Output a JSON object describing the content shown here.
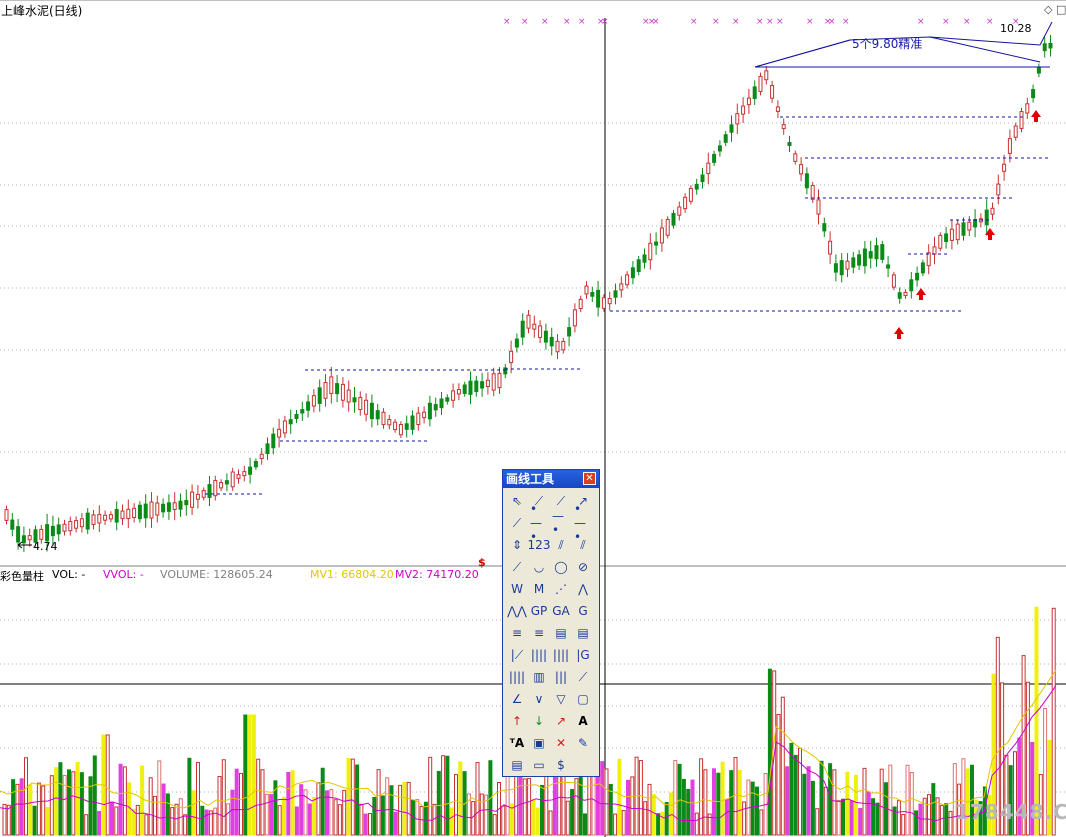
{
  "stock_title": "上峰水泥(日线)",
  "price_labels": {
    "low": "4.74",
    "high": "10.28"
  },
  "annotation": "5个9.80精准",
  "indicator_header": {
    "name": "彩色量柱",
    "vol": "VOL: -",
    "vvol": "VVOL: -",
    "volume": "VOLUME: 128605.24",
    "mv1": "MV1: 66804.20",
    "mv2": "MV2: 74170.20"
  },
  "toolbox": {
    "title": "画线工具",
    "close_icon": "close-icon",
    "tools": [
      {
        "name": "pointer-tool",
        "glyph": "⇖"
      },
      {
        "name": "segment-tool",
        "glyph": "⟋"
      },
      {
        "name": "line-tool",
        "glyph": "⟋"
      },
      {
        "name": "arrow-line-tool",
        "glyph": "↗"
      },
      {
        "name": "ray-tool",
        "glyph": "⟋"
      },
      {
        "name": "horizontal-segment-tool",
        "glyph": "•—•"
      },
      {
        "name": "horizontal-line-tool",
        "glyph": "—•"
      },
      {
        "name": "horizontal-ray-tool",
        "glyph": "•—•"
      },
      {
        "name": "vertical-line-tool",
        "glyph": "⇕"
      },
      {
        "name": "price-label-tool",
        "glyph": "123"
      },
      {
        "name": "parallel-line-tool",
        "glyph": "⫽"
      },
      {
        "name": "channel-tool",
        "glyph": "⫽"
      },
      {
        "name": "regression-tool",
        "glyph": "⟋"
      },
      {
        "name": "arc-tool",
        "glyph": "◡"
      },
      {
        "name": "circle-tool",
        "glyph": "◯"
      },
      {
        "name": "ellipse-tool",
        "glyph": "⊘"
      },
      {
        "name": "wave-tool",
        "glyph": "W"
      },
      {
        "name": "peak-tool",
        "glyph": "M"
      },
      {
        "name": "trend-tool",
        "glyph": "⋰"
      },
      {
        "name": "zigzag-tool",
        "glyph": "⋀"
      },
      {
        "name": "cycle-tool",
        "glyph": "⋀⋀"
      },
      {
        "name": "gp-tool",
        "glyph": "GP"
      },
      {
        "name": "ga-tool",
        "glyph": "GA"
      },
      {
        "name": "g-tool",
        "glyph": "G"
      },
      {
        "name": "fibonacci-tool",
        "glyph": "≡"
      },
      {
        "name": "percent-tool",
        "glyph": "≡"
      },
      {
        "name": "speed-tool",
        "glyph": "▤"
      },
      {
        "name": "gann-tool",
        "glyph": "▤"
      },
      {
        "name": "time-line-tool",
        "glyph": "|⟋"
      },
      {
        "name": "period-line-tool",
        "glyph": "||||"
      },
      {
        "name": "fib-time-tool",
        "glyph": "||||"
      },
      {
        "name": "time-g-tool",
        "glyph": "|G"
      },
      {
        "name": "bar-tool",
        "glyph": "||||"
      },
      {
        "name": "square-time-tool",
        "glyph": "▥"
      },
      {
        "name": "multi-line-tool",
        "glyph": "|||"
      },
      {
        "name": "fan-tool",
        "glyph": "⟋"
      },
      {
        "name": "angle-tool",
        "glyph": "∠"
      },
      {
        "name": "down-angle-tool",
        "glyph": "∨"
      },
      {
        "name": "triangle-tool",
        "glyph": "▽"
      },
      {
        "name": "rectangle-tool",
        "glyph": "▢"
      },
      {
        "name": "up-arrow-tool",
        "glyph": "↑"
      },
      {
        "name": "down-arrow-tool",
        "glyph": "↓"
      },
      {
        "name": "arrow-tool",
        "glyph": "↗"
      },
      {
        "name": "text-tool",
        "glyph": "A"
      },
      {
        "name": "text-annotate-tool",
        "glyph": "ᵀA"
      },
      {
        "name": "hide-tool",
        "glyph": "▣"
      },
      {
        "name": "delete-tool",
        "glyph": "✕"
      },
      {
        "name": "pen-tool",
        "glyph": "✎"
      },
      {
        "name": "list-tool",
        "glyph": "▤"
      },
      {
        "name": "ruler-tool",
        "glyph": "▭"
      },
      {
        "name": "dollar-tool",
        "glyph": "$"
      }
    ]
  },
  "watermark": "178448.COM",
  "colors": {
    "up": "#c83232",
    "down": "#0b8a17",
    "dash": "#1414a0",
    "marker": "#cc33cc",
    "mv1": "#e0c800",
    "mv2": "#cc00cc",
    "vol_yellow": "#f0f010",
    "vol_magenta": "#e040e0"
  }
}
